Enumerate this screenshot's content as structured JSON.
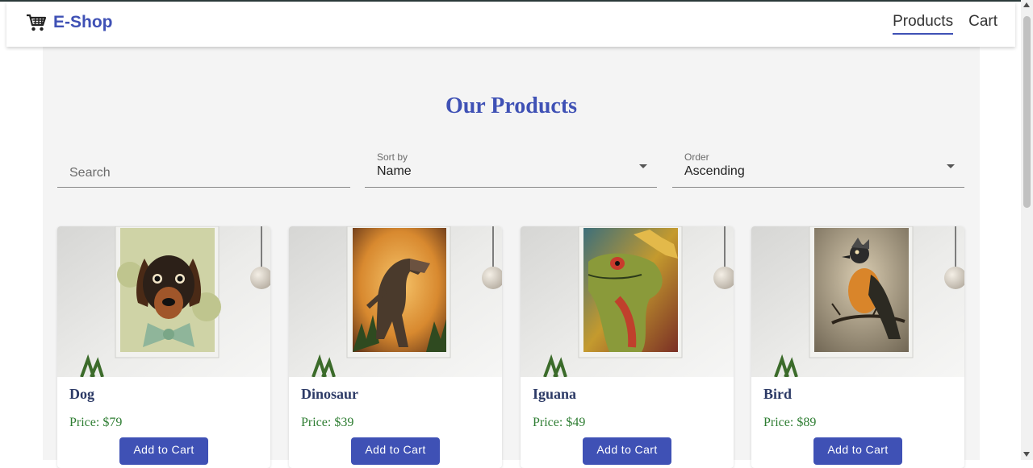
{
  "header": {
    "brand": "E-Shop",
    "brand_icon": "shopping-cart-icon",
    "nav": [
      {
        "label": "Products",
        "active": true
      },
      {
        "label": "Cart",
        "active": false
      }
    ]
  },
  "main": {
    "title": "Our Products",
    "search": {
      "placeholder": "Search",
      "value": ""
    },
    "sort": {
      "label": "Sort by",
      "value": "Name"
    },
    "order": {
      "label": "Order",
      "value": "Ascending"
    }
  },
  "products": [
    {
      "name": "Dog",
      "price": "Price: $79",
      "button": "Add to Cart",
      "image": "dachshund-with-bowtie-portrait"
    },
    {
      "name": "Dinosaur",
      "price": "Price: $39",
      "button": "Add to Cart",
      "image": "t-rex-in-forest-portrait"
    },
    {
      "name": "Iguana",
      "price": "Price: $49",
      "button": "Add to Cart",
      "image": "colorful-iguana-portrait"
    },
    {
      "name": "Bird",
      "price": "Price: $89",
      "button": "Add to Cart",
      "image": "bird-on-branch-portrait"
    }
  ],
  "colors": {
    "primary": "#3f51b5",
    "price": "#2e7d32",
    "page_bg": "#f4f4f4"
  }
}
